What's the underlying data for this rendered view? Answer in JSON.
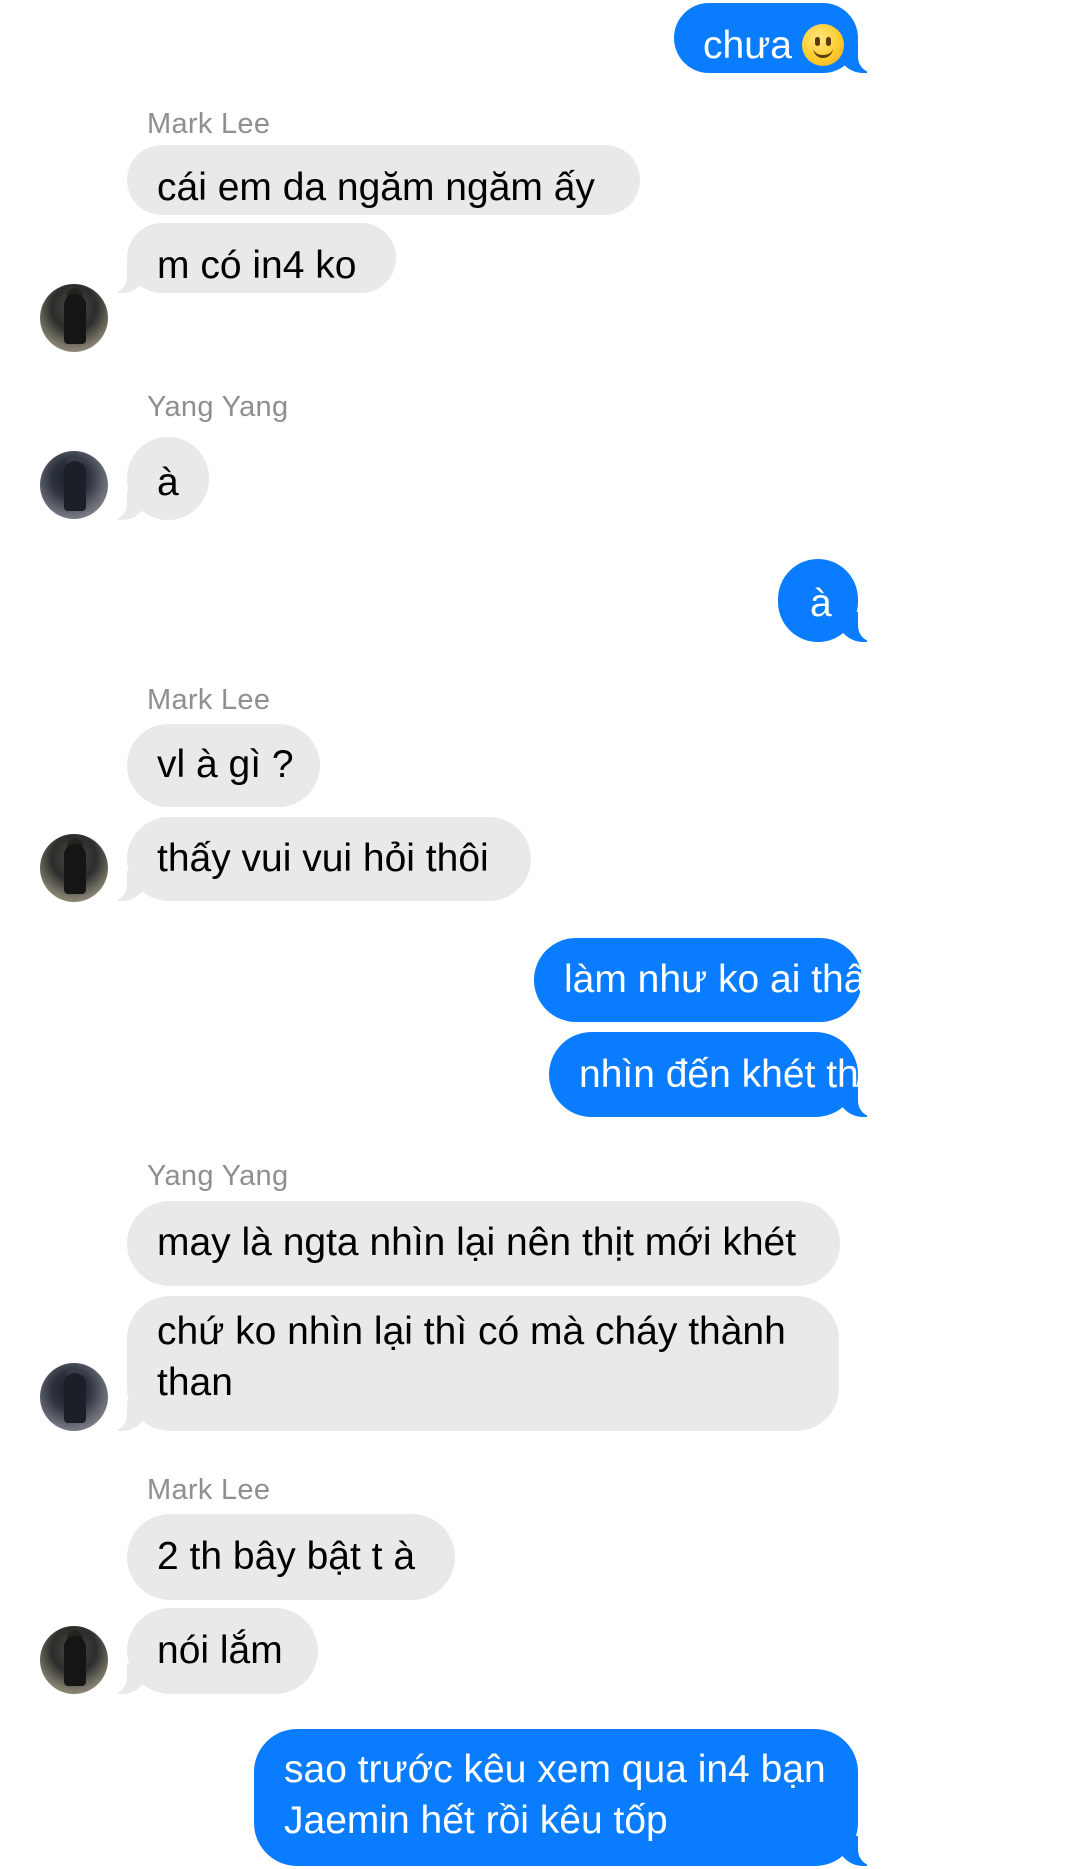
{
  "messages": [
    {
      "from": "me",
      "text": "chưa",
      "emoji": "slightly-smiling-face"
    },
    {
      "sender": "Mark Lee"
    },
    {
      "from": "Mark Lee",
      "text": "cái em da ngăm ngăm ấy"
    },
    {
      "from": "Mark Lee",
      "text": "m có in4 ko"
    },
    {
      "sender": "Yang Yang"
    },
    {
      "from": "Yang Yang",
      "text": "à"
    },
    {
      "from": "me",
      "text": "à"
    },
    {
      "sender": "Mark Lee"
    },
    {
      "from": "Mark Lee",
      "text": "vl à gì ?"
    },
    {
      "from": "Mark Lee",
      "text": "thấy vui vui hỏi thôi"
    },
    {
      "from": "me",
      "text": "làm như ko ai thấy"
    },
    {
      "from": "me",
      "text": "nhìn đến khét thịt"
    },
    {
      "sender": "Yang Yang"
    },
    {
      "from": "Yang Yang",
      "text": "may là ngta nhìn lại nên thịt mới khét"
    },
    {
      "from": "Yang Yang",
      "text": "chứ ko nhìn lại thì có mà cháy thành than"
    },
    {
      "sender": "Mark Lee"
    },
    {
      "from": "Mark Lee",
      "text": "2 th bây bật t à"
    },
    {
      "from": "Mark Lee",
      "text": "nói lắm"
    },
    {
      "from": "me",
      "text": "sao trước kêu xem qua in4 bạn Jaemin hết rồi kêu tốp"
    }
  ],
  "colors": {
    "outgoing_bubble": "#0a7cff",
    "incoming_bubble": "#e9e9eb",
    "sender_label": "#8e8e93"
  },
  "avatars": {
    "mark_lee": "avatar-photo",
    "yang_yang": "avatar-photo"
  }
}
